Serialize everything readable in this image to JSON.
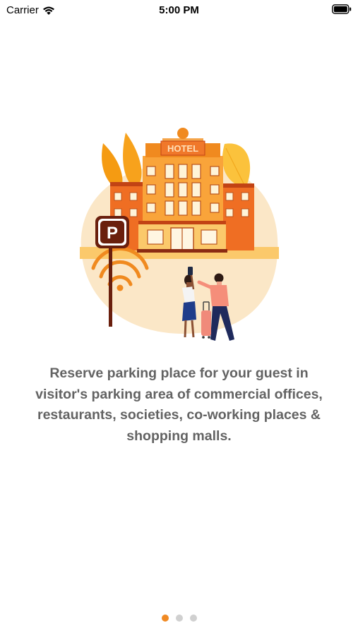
{
  "status_bar": {
    "carrier": "Carrier",
    "time": "5:00 PM"
  },
  "onboarding": {
    "illustration_icon": "hotel-parking-illustration",
    "illustration_sign": "P",
    "illustration_hotel_label": "HOTEL",
    "description": "Reserve parking place for your guest in visitor's parking area of commercial offices, restaurants, societies, co-working places & shopping malls."
  },
  "pager": {
    "total": 3,
    "active_index": 0
  },
  "colors": {
    "accent": "#f08a24",
    "text": "#636363",
    "dot_inactive": "#d0d0d0"
  }
}
